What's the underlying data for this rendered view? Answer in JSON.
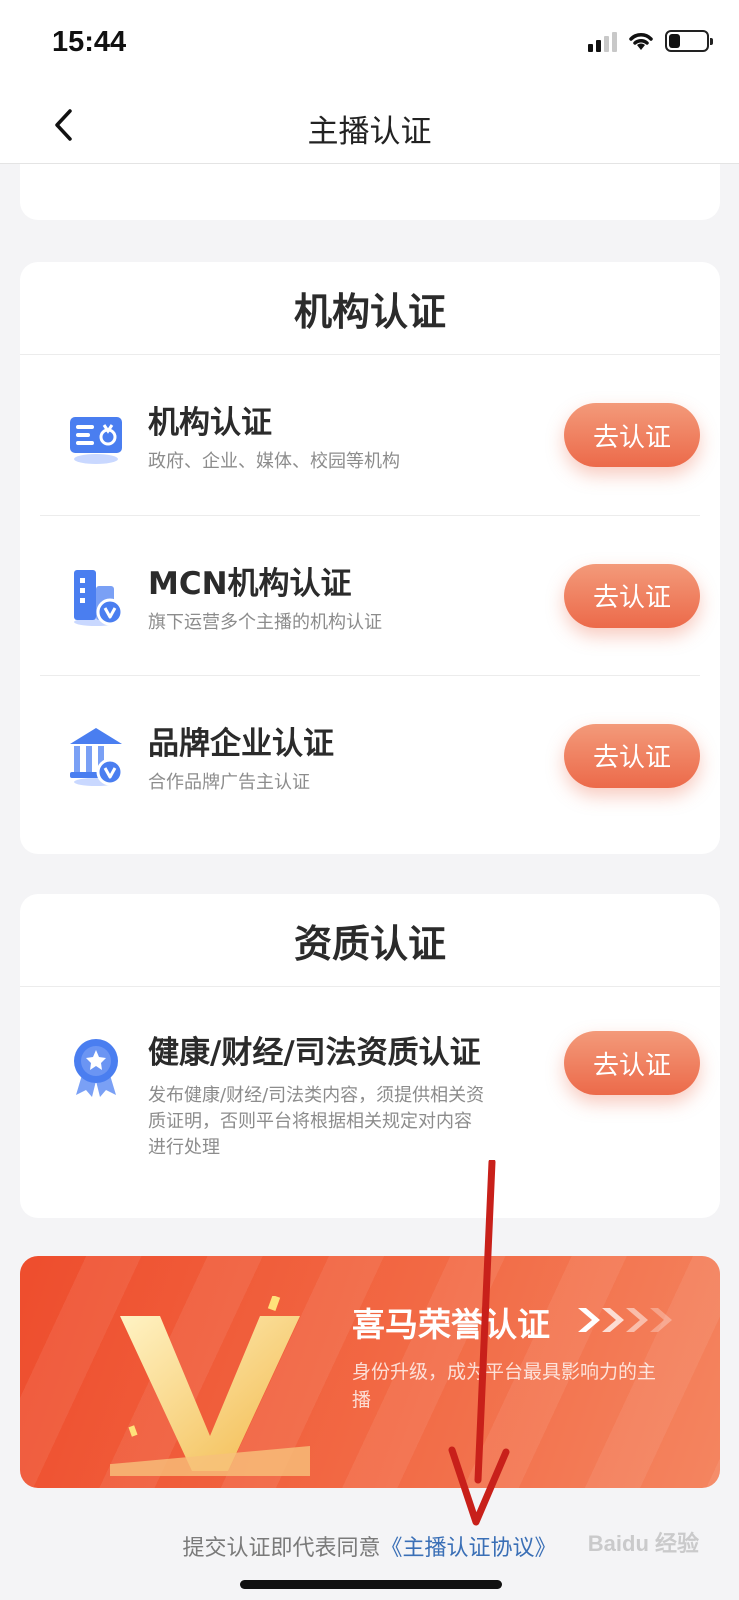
{
  "status_bar": {
    "time": "15:44"
  },
  "nav": {
    "title": "主播认证"
  },
  "org_section": {
    "header": "机构认证",
    "items": [
      {
        "title": "机构认证",
        "subtitle": "政府、企业、媒体、校园等机构",
        "button": "去认证",
        "icon": "id-card-icon"
      },
      {
        "title": "MCN机构认证",
        "subtitle": "旗下运营多个主播的机构认证",
        "button": "去认证",
        "icon": "building-verified-icon"
      },
      {
        "title": "品牌企业认证",
        "subtitle": "合作品牌广告主认证",
        "button": "去认证",
        "icon": "bank-verified-icon"
      }
    ]
  },
  "qual_section": {
    "header": "资质认证",
    "items": [
      {
        "title": "健康/财经/司法资质认证",
        "subtitle": "发布健康/财经/司法类内容，须提供相关资质证明，否则平台将根据相关规定对内容进行处理",
        "button": "去认证",
        "icon": "medal-icon"
      }
    ]
  },
  "banner": {
    "title": "喜马荣誉认证",
    "subtitle": "身份升级，成为平台最具影响力的主播"
  },
  "footer": {
    "agree_prefix": "提交认证即代表同意",
    "agree_link": "《主播认证协议》",
    "watermark": "Baidu 经验"
  },
  "colors": {
    "accent": "#ec6a4a",
    "link": "#3a6fb6",
    "icon_blue": "#4a7ef0"
  }
}
